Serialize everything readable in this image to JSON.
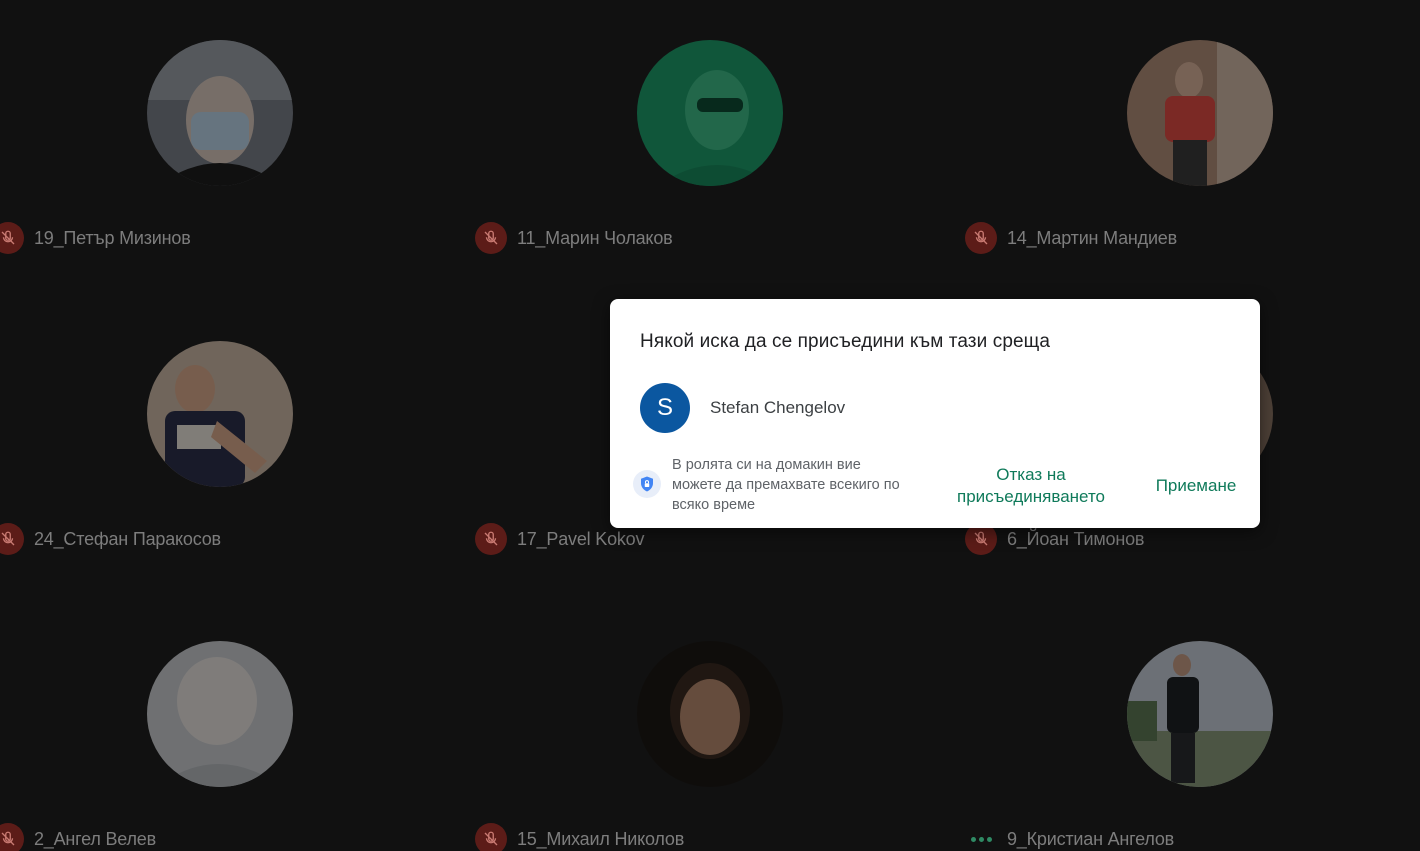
{
  "participants": [
    {
      "name": "19_Петър Мизинов",
      "status": "muted"
    },
    {
      "name": "11_Марин Чолаков",
      "status": "muted"
    },
    {
      "name": "14_Мартин Мандиев",
      "status": "muted"
    },
    {
      "name": "24_Стефан Паракосов",
      "status": "muted"
    },
    {
      "name": "17_Pavel Kokov",
      "status": "muted"
    },
    {
      "name": "6_Йоан Тимонов",
      "status": "muted"
    },
    {
      "name": "2_Ангел Велев",
      "status": "muted"
    },
    {
      "name": "15_Михаил Николов",
      "status": "muted"
    },
    {
      "name": "9_Кристиан Ангелов",
      "status": "speaking"
    }
  ],
  "dialog": {
    "title": "Някой иска да се присъедини към тази среща",
    "requester_initial": "S",
    "requester_name": "Stefan Chengelov",
    "host_note": "В ролята си на домакин вие можете да премахвате всекиго по всяко време",
    "deny_label": "Отказ на присъединяването",
    "accept_label": "Приемане"
  },
  "colors": {
    "background": "#111111",
    "muted_badge": "#5c1c18",
    "accent_green": "#0f7a5a",
    "requester_avatar": "#0b57a0"
  },
  "icons": {
    "muted": "mic-off-icon",
    "speaking": "more-dots-icon",
    "host_note": "shield-lock-icon"
  }
}
